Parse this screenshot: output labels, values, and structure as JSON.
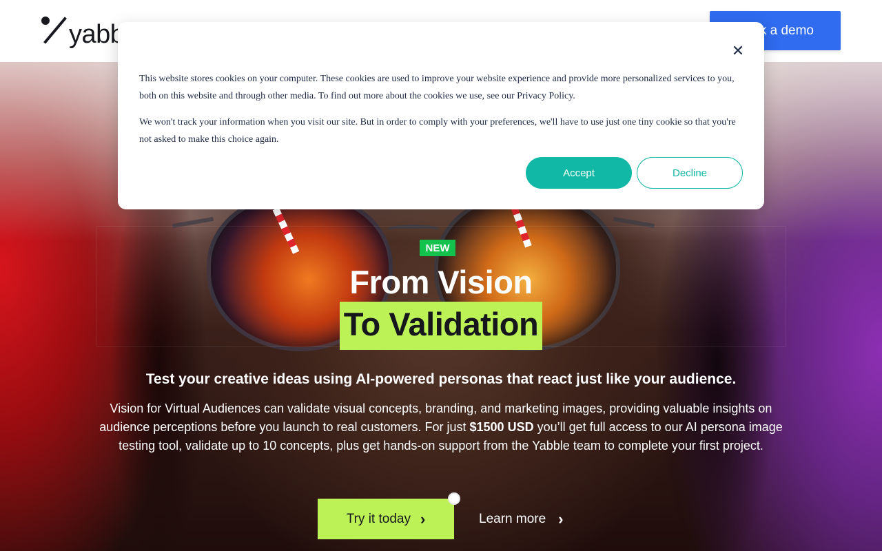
{
  "header": {
    "logo_text": "yabble",
    "demo_button_label": "Book a demo"
  },
  "hero": {
    "badge": "NEW",
    "headline_line1": "From Vision",
    "headline_line2": "To Validation",
    "subheadline": "Test your creative ideas using AI-powered personas that react just like your audience.",
    "body_part1": "Vision for Virtual Audiences can validate visual concepts, branding, and marketing images, providing valuable insights on audience perceptions before you launch to real customers. For just ",
    "body_price": "$1500 USD",
    "body_part2": " you’ll get full access to our AI persona image testing tool, validate up to 10 concepts, plus get hands-on support from the Yabble team to complete your first project.",
    "try_button_label": "Try it today",
    "learn_more_label": "Learn more"
  },
  "cookie_banner": {
    "paragraph1": "This website stores cookies on your computer. These cookies are used to improve your website experience and provide more personalized services to you, both on this website and through other media. To find out more about the cookies we use, see our Privacy Policy.",
    "paragraph2": "We won't track your information when you visit our site. But in order to comply with your preferences, we'll have to use just one tiny cookie so that you're not asked to make this choice again.",
    "accept_label": "Accept",
    "decline_label": "Decline",
    "close_glyph": "✕"
  },
  "icons": {
    "chevron": "›"
  },
  "colors": {
    "demo_button": "#2f6cf0",
    "accent_green": "#bdf257",
    "badge_green": "#12c24c",
    "teal": "#12b8a6",
    "cookie_text": "#1f2a44"
  }
}
